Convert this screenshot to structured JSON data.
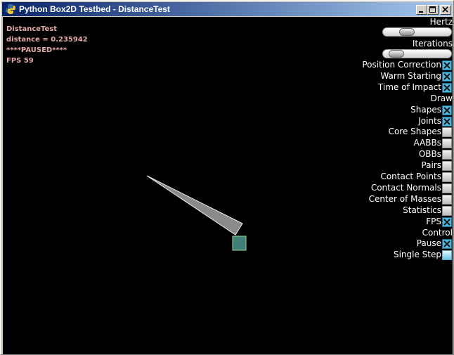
{
  "window": {
    "title": "Python Box2D Testbed - DistanceTest"
  },
  "info": {
    "test_name": "DistanceTest",
    "distance": "distance = 0.235942",
    "paused": "****PAUSED****",
    "fps": "FPS 59"
  },
  "panel": {
    "hertz_label": "Hertz",
    "iterations_label": "Iterations",
    "hertz_value_fraction": 0.3,
    "iterations_value_fraction": 0.1,
    "options": [
      {
        "label": "Position Correction",
        "checked": true
      },
      {
        "label": "Warm Starting",
        "checked": true
      },
      {
        "label": "Time of Impact",
        "checked": true
      }
    ],
    "draw_header": "Draw",
    "draw_options": [
      {
        "label": "Shapes",
        "checked": true
      },
      {
        "label": "Joints",
        "checked": true
      },
      {
        "label": "Core Shapes",
        "checked": false
      },
      {
        "label": "AABBs",
        "checked": false
      },
      {
        "label": "OBBs",
        "checked": false
      },
      {
        "label": "Pairs",
        "checked": false
      },
      {
        "label": "Contact Points",
        "checked": false
      },
      {
        "label": "Contact Normals",
        "checked": false
      },
      {
        "label": "Center of Masses",
        "checked": false
      },
      {
        "label": "Statistics",
        "checked": false
      },
      {
        "label": "FPS",
        "checked": true
      }
    ],
    "control_header": "Control",
    "pause": {
      "label": "Pause",
      "checked": true
    },
    "single_step": {
      "label": "Single Step"
    }
  },
  "colors": {
    "info_text": "#e5a9a9",
    "triangle_fill": "#8a8a8a",
    "triangle_stroke": "#f0f0f0",
    "box_fill": "#3f7f76",
    "box_stroke": "#9cd39c",
    "check_on": "#4ab7e0"
  }
}
